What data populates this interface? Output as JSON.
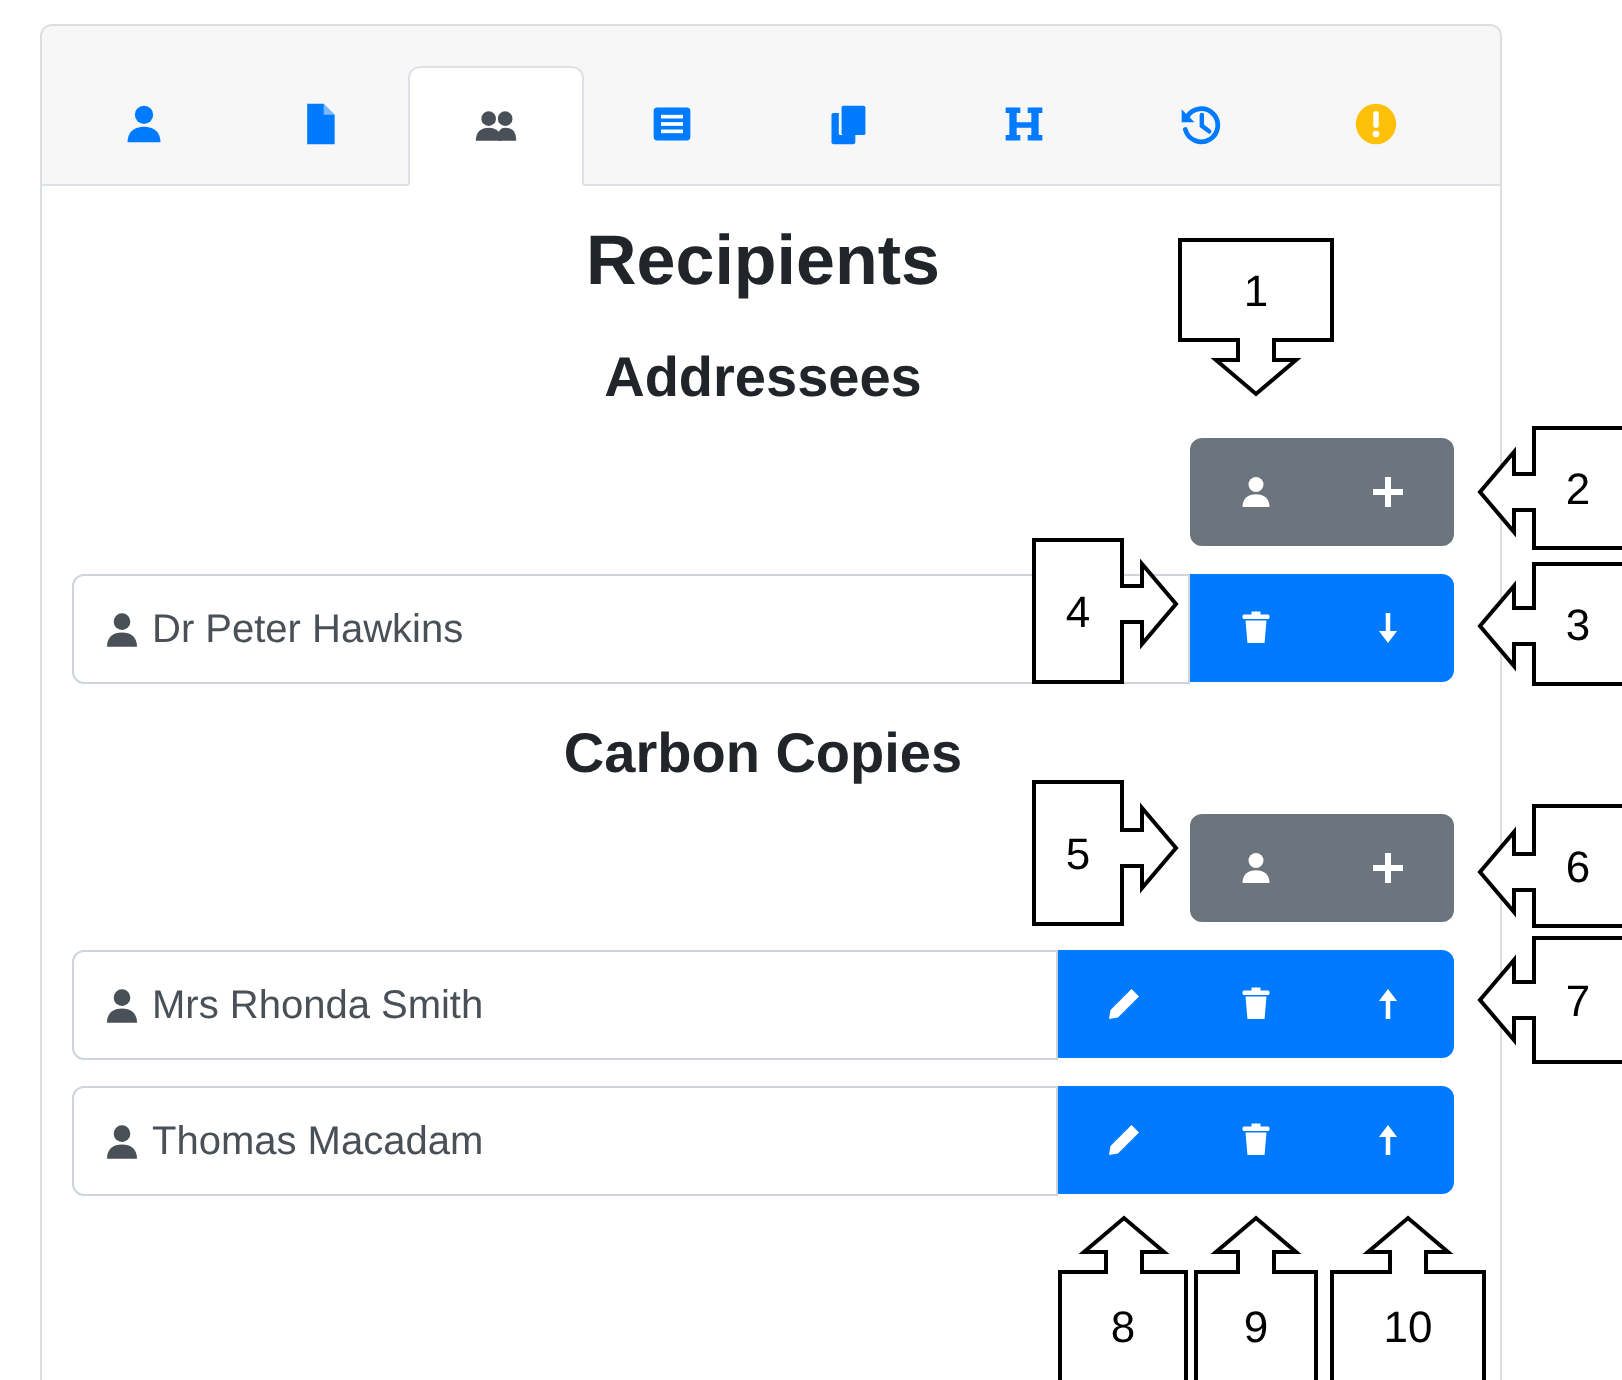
{
  "tabs": [
    {
      "kind": "person",
      "selected": false
    },
    {
      "kind": "file",
      "selected": false
    },
    {
      "kind": "people",
      "selected": true
    },
    {
      "kind": "list",
      "selected": false
    },
    {
      "kind": "copy",
      "selected": false
    },
    {
      "kind": "heading",
      "selected": false
    },
    {
      "kind": "history",
      "selected": false
    },
    {
      "kind": "warning",
      "selected": false
    }
  ],
  "title": "Recipients",
  "sections": [
    {
      "title": "Addressees",
      "recipients": [
        {
          "name": "Dr Peter Hawkins",
          "actions": [
            {
              "kind": "delete"
            },
            {
              "kind": "move-down"
            }
          ]
        }
      ]
    },
    {
      "title": "Carbon Copies",
      "recipients": [
        {
          "name": "Mrs Rhonda Smith",
          "actions": [
            {
              "kind": "edit"
            },
            {
              "kind": "delete"
            },
            {
              "kind": "move-up"
            }
          ]
        },
        {
          "name": "Thomas Macadam",
          "actions": [
            {
              "kind": "edit"
            },
            {
              "kind": "delete"
            },
            {
              "kind": "move-up"
            }
          ]
        }
      ]
    }
  ],
  "callouts": [
    {
      "label": "1"
    },
    {
      "label": "2"
    },
    {
      "label": "3"
    },
    {
      "label": "4"
    },
    {
      "label": "5"
    },
    {
      "label": "6"
    },
    {
      "label": "7"
    },
    {
      "label": "8"
    },
    {
      "label": "9"
    },
    {
      "label": "10"
    }
  ]
}
